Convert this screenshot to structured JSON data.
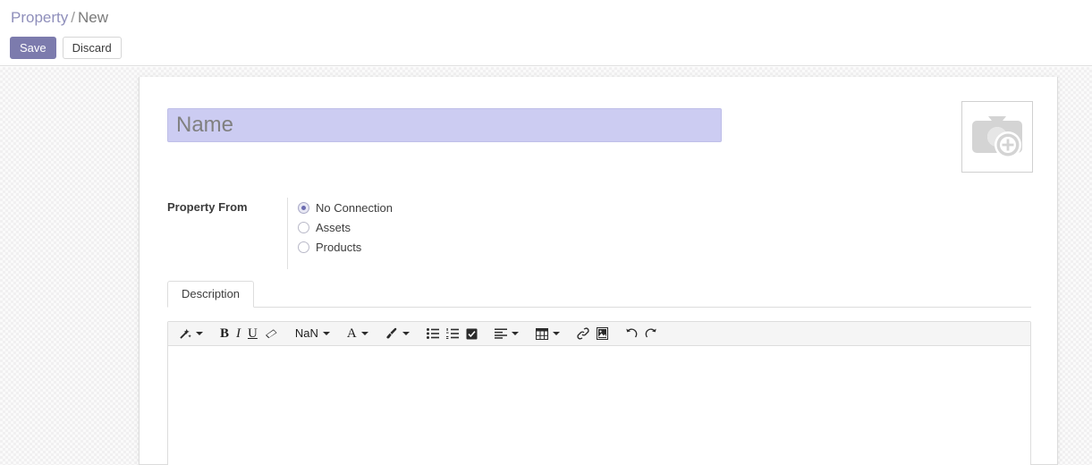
{
  "header": {
    "breadcrumb_root": "Property",
    "breadcrumb_separator": "/",
    "breadcrumb_current": "New",
    "save_label": "Save",
    "discard_label": "Discard"
  },
  "form": {
    "name_placeholder": "Name",
    "name_value": "",
    "image_placeholder_icon": "camera-add-icon",
    "property_from": {
      "label": "Property From",
      "selected": "No Connection",
      "options": [
        {
          "label": "No Connection",
          "checked": true
        },
        {
          "label": "Assets",
          "checked": false
        },
        {
          "label": "Products",
          "checked": false
        }
      ]
    },
    "tabs": [
      {
        "label": "Description",
        "active": true
      }
    ],
    "description_editor": {
      "content": "",
      "toolbar": [
        {
          "name": "style-magic-wand",
          "type": "icon",
          "icon": "magic-wand-icon",
          "caret": true
        },
        {
          "name": "bold",
          "type": "text",
          "label": "B"
        },
        {
          "name": "italic",
          "type": "text",
          "label": "I"
        },
        {
          "name": "underline",
          "type": "text",
          "label": "U"
        },
        {
          "name": "remove-format",
          "type": "icon",
          "icon": "eraser-icon",
          "caret": false
        },
        {
          "name": "font-size",
          "type": "text",
          "label": "NaN",
          "caret": true
        },
        {
          "name": "font-color",
          "type": "text",
          "label": "A",
          "caret": true
        },
        {
          "name": "background-color",
          "type": "icon",
          "icon": "paintbrush-icon",
          "caret": true
        },
        {
          "name": "unordered-list",
          "type": "icon",
          "icon": "bullet-list-icon",
          "caret": false
        },
        {
          "name": "ordered-list",
          "type": "icon",
          "icon": "numbered-list-icon",
          "caret": false
        },
        {
          "name": "checklist",
          "type": "icon",
          "icon": "checkbox-checked-icon",
          "caret": false
        },
        {
          "name": "align",
          "type": "icon",
          "icon": "align-left-icon",
          "caret": true
        },
        {
          "name": "table",
          "type": "icon",
          "icon": "table-icon",
          "caret": true
        },
        {
          "name": "link",
          "type": "icon",
          "icon": "link-icon",
          "caret": false
        },
        {
          "name": "image",
          "type": "icon",
          "icon": "image-icon",
          "caret": false
        },
        {
          "name": "undo",
          "type": "icon",
          "icon": "undo-icon",
          "caret": false
        },
        {
          "name": "redo",
          "type": "icon",
          "icon": "redo-icon",
          "caret": false
        }
      ]
    }
  },
  "colors": {
    "brand_purple": "#7c7bad",
    "name_field_bg": "#ccccf2",
    "radio_dot": "#6b6bb0",
    "sheet_bg": "#ffffff"
  }
}
